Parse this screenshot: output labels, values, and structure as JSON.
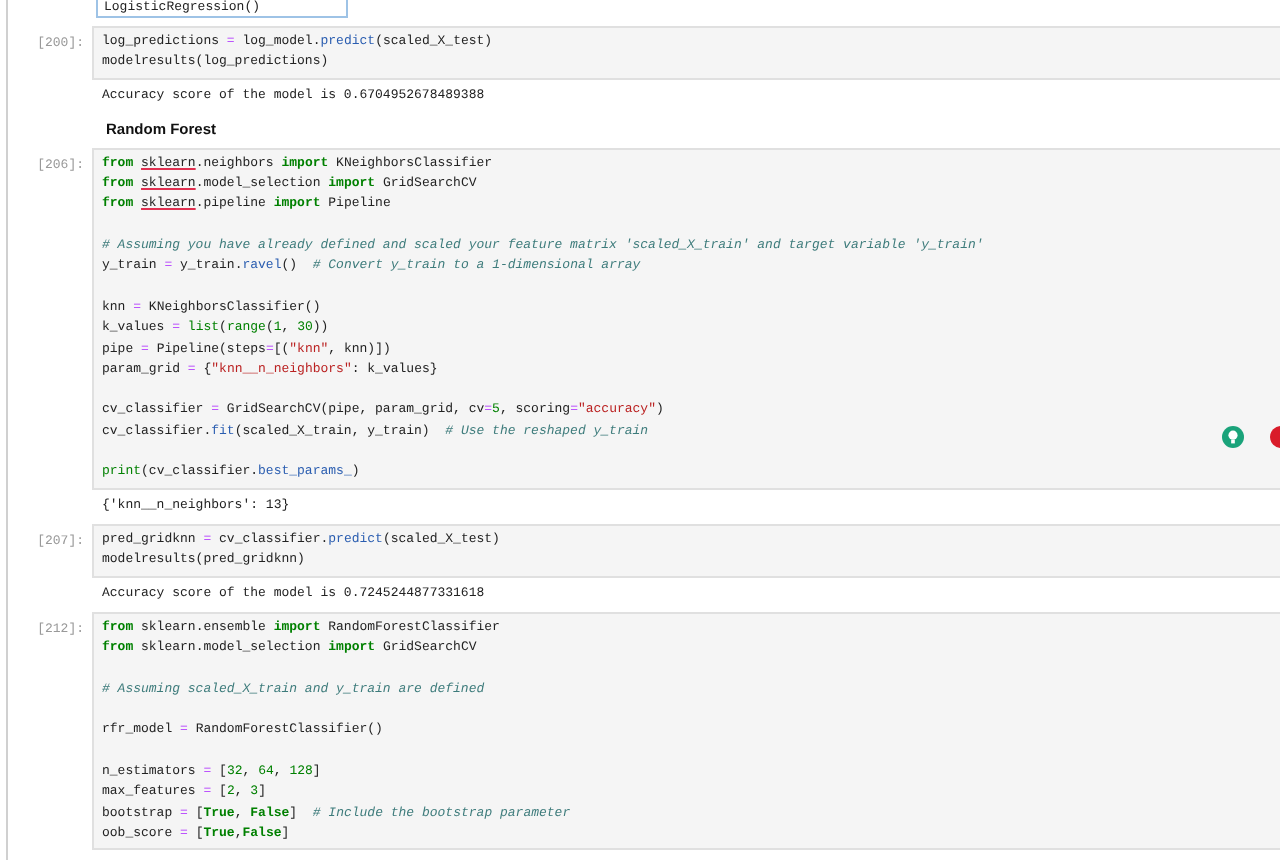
{
  "top_output": {
    "text": "LogisticRegression()"
  },
  "cells": [
    {
      "kind": "code",
      "prompt": "[200]:",
      "blocks": [
        [
          [
            {
              "text": "log_predictions ",
              "kind": "plain"
            },
            {
              "text": "=",
              "kind": "operator"
            },
            {
              "text": " log_model.",
              "kind": "plain"
            },
            {
              "text": "predict",
              "kind": "method"
            },
            {
              "text": "(scaled_X_test)",
              "kind": "plain"
            }
          ],
          [
            {
              "text": "modelresults(log_predictions)",
              "kind": "plain"
            }
          ]
        ]
      ],
      "outputs": [
        "Accuracy score of the model is 0.6704952678489388"
      ]
    },
    {
      "kind": "markdown",
      "text": "Random Forest"
    },
    {
      "kind": "code",
      "prompt": "[206]:",
      "blocks": [
        [
          [
            {
              "text": "from ",
              "kind": "keyword"
            },
            {
              "text": "sklearn",
              "kind": "flagged"
            },
            {
              "text": ".neighbors ",
              "kind": "plain"
            },
            {
              "text": "import",
              "kind": "keyword"
            },
            {
              "text": " KNeighborsClassifier",
              "kind": "plain"
            }
          ],
          [
            {
              "text": "from ",
              "kind": "keyword"
            },
            {
              "text": "sklearn",
              "kind": "flagged"
            },
            {
              "text": ".model_selection ",
              "kind": "plain"
            },
            {
              "text": "import",
              "kind": "keyword"
            },
            {
              "text": " GridSearchCV",
              "kind": "plain"
            }
          ],
          [
            {
              "text": "from ",
              "kind": "keyword"
            },
            {
              "text": "sklearn",
              "kind": "flagged"
            },
            {
              "text": ".pipeline ",
              "kind": "plain"
            },
            {
              "text": "import",
              "kind": "keyword"
            },
            {
              "text": " Pipeline",
              "kind": "plain"
            }
          ]
        ],
        [
          [
            {
              "text": "# Assuming you have already defined and scaled your feature matrix 'scaled_X_train' and target variable 'y_train'",
              "kind": "comment"
            }
          ],
          [
            {
              "text": "y_train ",
              "kind": "plain"
            },
            {
              "text": "=",
              "kind": "operator"
            },
            {
              "text": " y_train.",
              "kind": "plain"
            },
            {
              "text": "ravel",
              "kind": "method"
            },
            {
              "text": "()  ",
              "kind": "plain"
            },
            {
              "text": "# Convert y_train to a 1-dimensional array",
              "kind": "comment"
            }
          ]
        ],
        [
          [
            {
              "text": "knn ",
              "kind": "plain"
            },
            {
              "text": "=",
              "kind": "operator"
            },
            {
              "text": " KNeighborsClassifier()",
              "kind": "plain"
            }
          ],
          [
            {
              "text": "k_values ",
              "kind": "plain"
            },
            {
              "text": "= ",
              "kind": "operator"
            },
            {
              "text": "list",
              "kind": "builtin"
            },
            {
              "text": "(",
              "kind": "plain"
            },
            {
              "text": "range",
              "kind": "builtin"
            },
            {
              "text": "(",
              "kind": "plain"
            },
            {
              "text": "1",
              "kind": "number"
            },
            {
              "text": ", ",
              "kind": "plain"
            },
            {
              "text": "30",
              "kind": "number"
            },
            {
              "text": "))",
              "kind": "plain"
            }
          ],
          [
            {
              "text": "pipe ",
              "kind": "plain"
            },
            {
              "text": "=",
              "kind": "operator"
            },
            {
              "text": " Pipeline(steps",
              "kind": "plain"
            },
            {
              "text": "=",
              "kind": "operator"
            },
            {
              "text": "[(",
              "kind": "plain"
            },
            {
              "text": "\"knn\"",
              "kind": "string"
            },
            {
              "text": ", knn)])",
              "kind": "plain"
            }
          ],
          [
            {
              "text": "param_grid ",
              "kind": "plain"
            },
            {
              "text": "=",
              "kind": "operator"
            },
            {
              "text": " {",
              "kind": "plain"
            },
            {
              "text": "\"knn__n_neighbors\"",
              "kind": "string"
            },
            {
              "text": ": k_values}",
              "kind": "plain"
            }
          ]
        ],
        [
          [
            {
              "text": "cv_classifier ",
              "kind": "plain"
            },
            {
              "text": "=",
              "kind": "operator"
            },
            {
              "text": " GridSearchCV(pipe, param_grid, cv",
              "kind": "plain"
            },
            {
              "text": "=",
              "kind": "operator"
            },
            {
              "text": "5",
              "kind": "number"
            },
            {
              "text": ", scoring",
              "kind": "plain"
            },
            {
              "text": "=",
              "kind": "operator"
            },
            {
              "text": "\"accuracy\"",
              "kind": "string"
            },
            {
              "text": ")",
              "kind": "plain"
            }
          ],
          [
            {
              "text": "cv_classifier.",
              "kind": "plain"
            },
            {
              "text": "fit",
              "kind": "method"
            },
            {
              "text": "(scaled_X_train, y_train)  ",
              "kind": "plain"
            },
            {
              "text": "# Use the reshaped y_train",
              "kind": "comment"
            }
          ]
        ],
        [
          [
            {
              "text": "print",
              "kind": "builtin"
            },
            {
              "text": "(cv_classifier.",
              "kind": "plain"
            },
            {
              "text": "best_params_",
              "kind": "method"
            },
            {
              "text": ")",
              "kind": "plain"
            }
          ]
        ]
      ],
      "outputs": [
        "{'knn__n_neighbors': 13}"
      ]
    },
    {
      "kind": "code",
      "prompt": "[207]:",
      "blocks": [
        [
          [
            {
              "text": "pred_gridknn ",
              "kind": "plain"
            },
            {
              "text": "=",
              "kind": "operator"
            },
            {
              "text": " cv_classifier.",
              "kind": "plain"
            },
            {
              "text": "predict",
              "kind": "method"
            },
            {
              "text": "(scaled_X_test)",
              "kind": "plain"
            }
          ],
          [
            {
              "text": "modelresults(pred_gridknn)",
              "kind": "plain"
            }
          ]
        ]
      ],
      "outputs": [
        "Accuracy score of the model is 0.7245244877331618"
      ]
    },
    {
      "kind": "code",
      "prompt": "[212]:",
      "blocks": [
        [
          [
            {
              "text": "from",
              "kind": "keyword"
            },
            {
              "text": " sklearn.ensemble ",
              "kind": "plain"
            },
            {
              "text": "import",
              "kind": "keyword"
            },
            {
              "text": " RandomForestClassifier",
              "kind": "plain"
            }
          ],
          [
            {
              "text": "from",
              "kind": "keyword"
            },
            {
              "text": " sklearn.model_selection ",
              "kind": "plain"
            },
            {
              "text": "import",
              "kind": "keyword"
            },
            {
              "text": " GridSearchCV",
              "kind": "plain"
            }
          ]
        ],
        [
          [
            {
              "text": "# Assuming scaled_X_train and y_train are defined",
              "kind": "comment"
            }
          ]
        ],
        [
          [
            {
              "text": "rfr_model ",
              "kind": "plain"
            },
            {
              "text": "=",
              "kind": "operator"
            },
            {
              "text": " RandomForestClassifier()",
              "kind": "plain"
            }
          ]
        ],
        [
          [
            {
              "text": "n_estimators ",
              "kind": "plain"
            },
            {
              "text": "=",
              "kind": "operator"
            },
            {
              "text": " [",
              "kind": "plain"
            },
            {
              "text": "32",
              "kind": "number"
            },
            {
              "text": ", ",
              "kind": "plain"
            },
            {
              "text": "64",
              "kind": "number"
            },
            {
              "text": ", ",
              "kind": "plain"
            },
            {
              "text": "128",
              "kind": "number"
            },
            {
              "text": "]",
              "kind": "plain"
            }
          ],
          [
            {
              "text": "max_features ",
              "kind": "plain"
            },
            {
              "text": "=",
              "kind": "operator"
            },
            {
              "text": " [",
              "kind": "plain"
            },
            {
              "text": "2",
              "kind": "number"
            },
            {
              "text": ", ",
              "kind": "plain"
            },
            {
              "text": "3",
              "kind": "number"
            },
            {
              "text": "]",
              "kind": "plain"
            }
          ],
          [
            {
              "text": "bootstrap ",
              "kind": "plain"
            },
            {
              "text": "=",
              "kind": "operator"
            },
            {
              "text": " [",
              "kind": "plain"
            },
            {
              "text": "True",
              "kind": "keyword"
            },
            {
              "text": ", ",
              "kind": "plain"
            },
            {
              "text": "False",
              "kind": "keyword"
            },
            {
              "text": "]  ",
              "kind": "plain"
            },
            {
              "text": "# Include the bootstrap parameter",
              "kind": "comment"
            }
          ],
          [
            {
              "text": "oob_score ",
              "kind": "plain"
            },
            {
              "text": "=",
              "kind": "operator"
            },
            {
              "text": " [",
              "kind": "plain"
            },
            {
              "text": "True",
              "kind": "keyword"
            },
            {
              "text": ",",
              "kind": "plain"
            },
            {
              "text": "False",
              "kind": "keyword"
            },
            {
              "text": "]",
              "kind": "plain"
            }
          ]
        ]
      ]
    }
  ]
}
